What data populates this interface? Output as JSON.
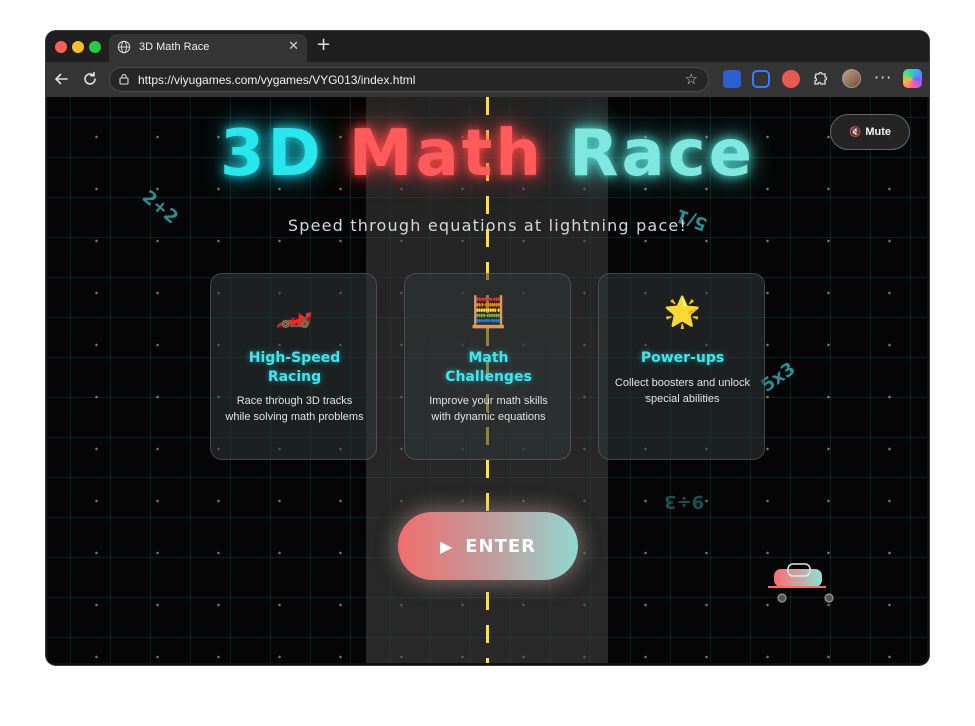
{
  "browser": {
    "tab_title": "3D Math Race",
    "tab_close": "✕",
    "new_tab": "+",
    "url": "https://viyugames.com/vygames/VYG013/index.html"
  },
  "game": {
    "title_part1": "3D",
    "title_part2": "Math",
    "title_part3": "Race",
    "subtitle": "Speed through equations at lightning pace!",
    "mute_label": "Mute",
    "mute_icon": "🔇",
    "floating_equations": [
      "2+2",
      "5/1",
      "5x3",
      "9÷3"
    ],
    "features": [
      {
        "icon": "🏎️",
        "title": "High-Speed Racing",
        "description": "Race through 3D tracks while solving math problems"
      },
      {
        "icon": "🧮",
        "title": "Math Challenges",
        "description": "Improve your math skills with dynamic equations"
      },
      {
        "icon": "🌟",
        "title": "Power-ups",
        "description": "Collect boosters and unlock special abilities"
      }
    ],
    "enter_icon": "▶",
    "enter_label": "ENTER"
  },
  "colors": {
    "title_3d": "#27e6ee",
    "title_math": "#ff5b5b",
    "title_race": "#7ee8e0",
    "feature_title": "#3fe6ee",
    "lane_line": "#ffe23b"
  }
}
